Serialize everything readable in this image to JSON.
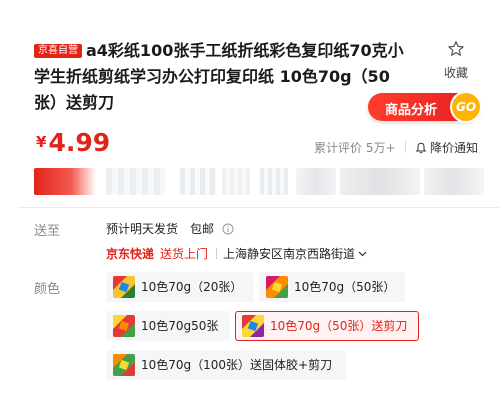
{
  "product": {
    "badge": "京喜自营",
    "title": "a4彩纸100张手工纸折纸彩色复印纸70克小学生折纸剪纸学习办公打印复印纸 10色70g（50张）送剪刀"
  },
  "favorite": {
    "label": "收藏",
    "icon": "star-icon"
  },
  "analysis": {
    "label": "商品分析",
    "go": "GO"
  },
  "price": {
    "symbol": "¥",
    "value": "4.99"
  },
  "reviews": {
    "label": "累计评价",
    "count": "5万+"
  },
  "notify": {
    "label": "降价通知",
    "icon": "bell-icon"
  },
  "shipping": {
    "label": "送至",
    "eta": "预计明天发货",
    "free": "包邮",
    "express": "京东快递",
    "door": "送货上门",
    "address": "上海静安区南京西路街道"
  },
  "colors": {
    "label": "颜色",
    "options": [
      {
        "label": "10色70g（20张）",
        "selected": false
      },
      {
        "label": "10色70g（50张）",
        "selected": false
      },
      {
        "label": "10色70g50张",
        "selected": false
      },
      {
        "label": "10色70g（50张）送剪刀",
        "selected": true
      },
      {
        "label": "10色70g（100张）送固体胶+剪刀",
        "selected": false
      }
    ]
  },
  "theme": {
    "accent": "#e2231a",
    "go": "#ffb400"
  }
}
